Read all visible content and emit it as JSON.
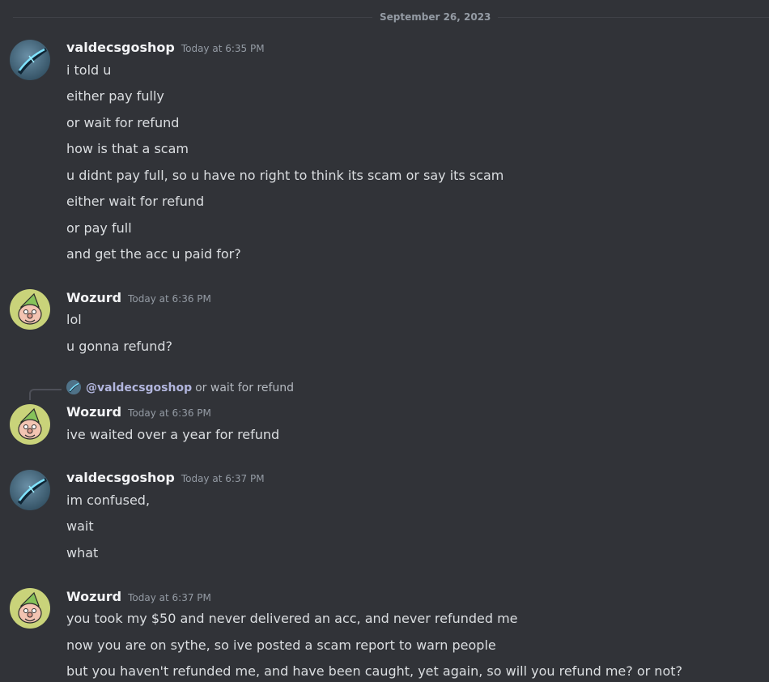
{
  "date_divider": "September 26, 2023",
  "messages": [
    {
      "author": "valdecsgoshop",
      "time": "Today at 6:35 PM",
      "avatar": "blade-avatar-icon",
      "lines": [
        "i told u",
        "either pay fully",
        "or wait for refund",
        "how is that a scam",
        "u didnt pay full, so u have no right to think its scam or say its scam",
        "either wait for refund",
        "or pay full",
        "and get the acc u paid for?"
      ]
    },
    {
      "author": "Wozurd",
      "time": "Today at 6:36 PM",
      "avatar": "gnome-avatar-icon",
      "lines": [
        "lol",
        "u gonna refund?"
      ]
    },
    {
      "author": "Wozurd",
      "time": "Today at 6:36 PM",
      "avatar": "gnome-avatar-icon",
      "reply": {
        "mention": "@valdecsgoshop",
        "text": "or wait for refund"
      },
      "lines": [
        "ive waited over a year for refund"
      ]
    },
    {
      "author": "valdecsgoshop",
      "time": "Today at 6:37 PM",
      "avatar": "blade-avatar-icon",
      "lines": [
        "im confused,",
        "wait",
        "what"
      ]
    },
    {
      "author": "Wozurd",
      "time": "Today at 6:37 PM",
      "avatar": "gnome-avatar-icon",
      "lines": [
        "you took my $50 and never delivered an acc, and never refunded me",
        "now you are on sythe, so ive posted a scam report to warn people",
        "but you haven't refunded me, and have been caught, yet again, so will you refund me? or not?"
      ]
    }
  ],
  "colors": {
    "background": "#313338",
    "username": "#f2f3f5",
    "timestamp": "#949ba4",
    "text": "#dbdee1",
    "mention": "#c9cdfb"
  }
}
